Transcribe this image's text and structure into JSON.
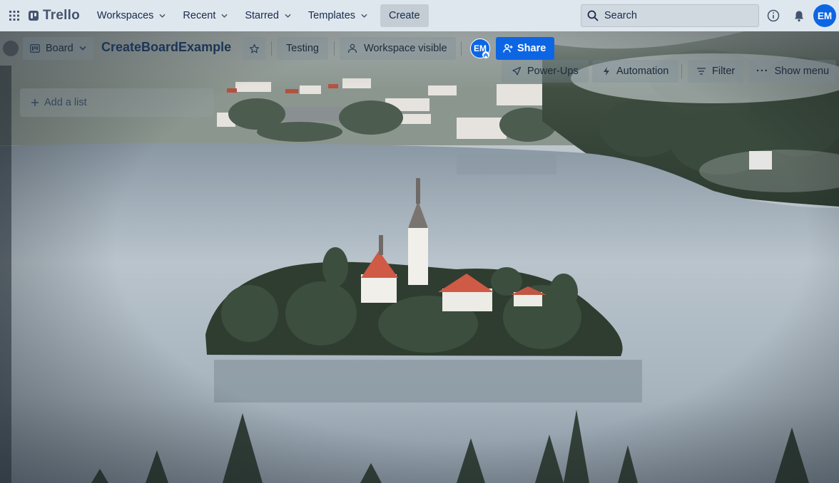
{
  "nav": {
    "brand": "Trello",
    "menus": [
      {
        "label": "Workspaces"
      },
      {
        "label": "Recent"
      },
      {
        "label": "Starred"
      },
      {
        "label": "Templates"
      }
    ],
    "create_label": "Create",
    "search_placeholder": "Search",
    "user_initials": "EM"
  },
  "board": {
    "view_label": "Board",
    "title": "CreateBoardExample",
    "label_testing": "Testing",
    "visibility_label": "Workspace visible",
    "member_initials": "EM",
    "share_label": "Share",
    "powerups_label": "Power-Ups",
    "automation_label": "Automation",
    "filter_label": "Filter",
    "menu_label": "Show menu",
    "add_list_label": "Add a list"
  },
  "colors": {
    "accent": "#0c66e4",
    "nav_bg": "#dfe7ee",
    "title": "#1b3558"
  }
}
